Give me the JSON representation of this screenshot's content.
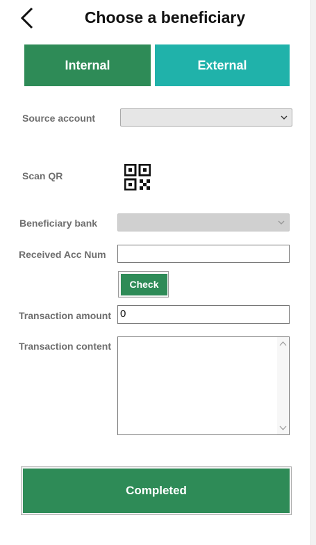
{
  "header": {
    "title": "Choose a beneficiary",
    "back_icon": "chevron-left-icon"
  },
  "tabs": [
    {
      "label": "Internal",
      "color": "#2e8b57"
    },
    {
      "label": "External",
      "color": "#20b2aa",
      "selected": true
    }
  ],
  "form": {
    "source_account": {
      "label": "Source account",
      "value": ""
    },
    "scan_qr": {
      "label": "Scan QR",
      "icon": "qr-code-icon"
    },
    "beneficiary_bank": {
      "label": "Beneficiary bank",
      "value": "",
      "disabled": true
    },
    "received_acc_num": {
      "label": "Received Acc Num",
      "value": ""
    },
    "check_button": {
      "label": "Check"
    },
    "transaction_amount": {
      "label": "Transaction amount",
      "value": "0"
    },
    "transaction_content": {
      "label": "Transaction content",
      "value": ""
    }
  },
  "footer": {
    "completed_label": "Completed"
  },
  "colors": {
    "primary": "#2e8b57",
    "accent": "#20b2aa"
  }
}
